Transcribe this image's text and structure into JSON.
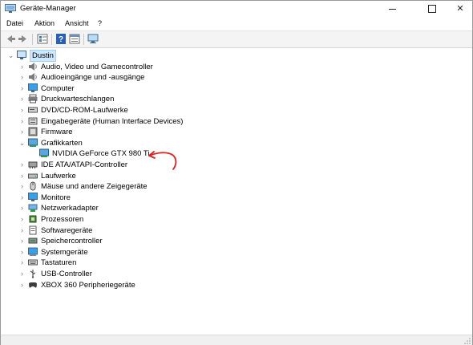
{
  "window": {
    "title": "Geräte-Manager",
    "close_glyph": "✕"
  },
  "menu": {
    "items": [
      {
        "label": "Datei"
      },
      {
        "label": "Aktion"
      },
      {
        "label": "Ansicht"
      },
      {
        "label": "?"
      }
    ]
  },
  "toolbar": {
    "buttons": [
      {
        "name": "back-arrow-icon"
      },
      {
        "name": "forward-arrow-icon"
      },
      {
        "name": "properties-icon"
      },
      {
        "name": "help-icon"
      },
      {
        "name": "details-view-icon"
      },
      {
        "name": "monitor-scan-icon"
      }
    ]
  },
  "tree": {
    "root": {
      "label": "Dustin",
      "expanded": true,
      "icon": "computer-icon"
    },
    "categories": [
      {
        "label": "Audio, Video und Gamecontroller",
        "icon": "speaker-icon",
        "expanded": false
      },
      {
        "label": "Audioeingänge und -ausgänge",
        "icon": "speaker-icon",
        "expanded": false
      },
      {
        "label": "Computer",
        "icon": "monitor-icon",
        "expanded": false
      },
      {
        "label": "Druckwarteschlangen",
        "icon": "printer-icon",
        "expanded": false
      },
      {
        "label": "DVD/CD-ROM-Laufwerke",
        "icon": "disc-drive-icon",
        "expanded": false
      },
      {
        "label": "Eingabegeräte (Human Interface Devices)",
        "icon": "hid-icon",
        "expanded": false
      },
      {
        "label": "Firmware",
        "icon": "firmware-icon",
        "expanded": false
      },
      {
        "label": "Grafikkarten",
        "icon": "display-adapter-icon",
        "expanded": true,
        "children": [
          {
            "label": "NVIDIA GeForce GTX 980 Ti",
            "icon": "display-adapter-icon"
          }
        ]
      },
      {
        "label": "IDE ATA/ATAPI-Controller",
        "icon": "ide-controller-icon",
        "expanded": false
      },
      {
        "label": "Laufwerke",
        "icon": "drive-icon",
        "expanded": false
      },
      {
        "label": "Mäuse und andere Zeigegeräte",
        "icon": "mouse-icon",
        "expanded": false
      },
      {
        "label": "Monitore",
        "icon": "monitor-icon",
        "expanded": false
      },
      {
        "label": "Netzwerkadapter",
        "icon": "network-icon",
        "expanded": false
      },
      {
        "label": "Prozessoren",
        "icon": "processor-icon",
        "expanded": false
      },
      {
        "label": "Softwaregeräte",
        "icon": "software-device-icon",
        "expanded": false
      },
      {
        "label": "Speichercontroller",
        "icon": "storage-controller-icon",
        "expanded": false
      },
      {
        "label": "Systemgeräte",
        "icon": "system-device-icon",
        "expanded": false
      },
      {
        "label": "Tastaturen",
        "icon": "keyboard-icon",
        "expanded": false
      },
      {
        "label": "USB-Controller",
        "icon": "usb-icon",
        "expanded": false
      },
      {
        "label": "XBOX 360 Peripheriegeräte",
        "icon": "gamepad-icon",
        "expanded": false
      }
    ]
  },
  "annotation": {
    "color": "#e02020"
  },
  "colors": {
    "selection_bg": "#cde8ff",
    "selection_border": "#99d1ff",
    "accent": "#1e6fc8"
  }
}
